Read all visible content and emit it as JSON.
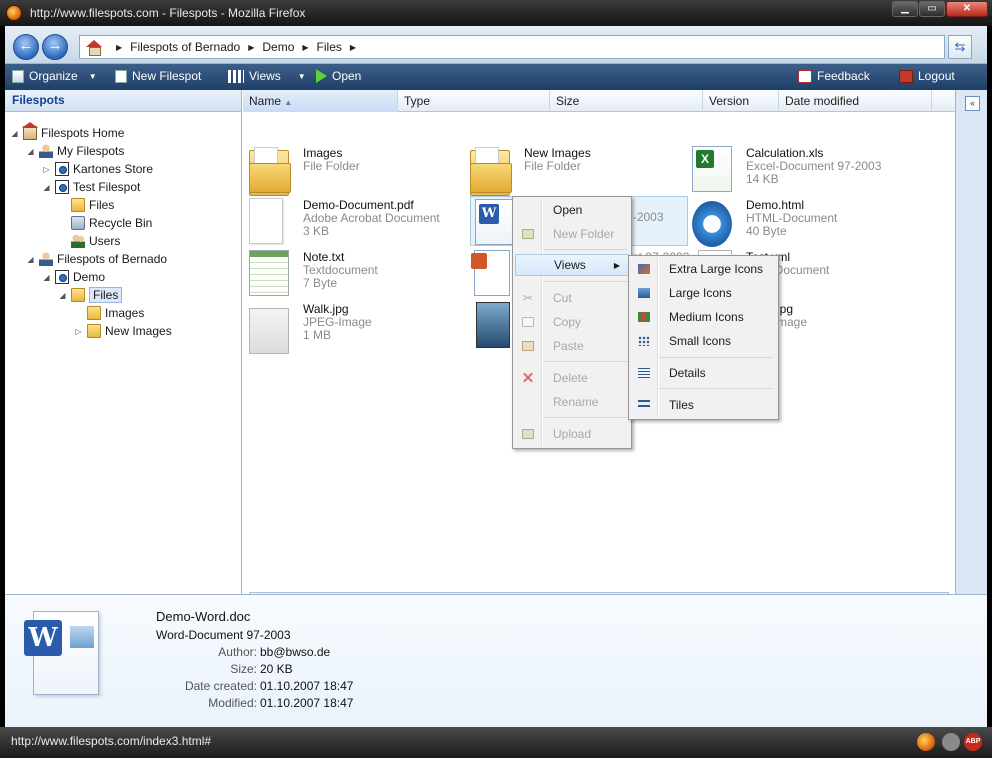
{
  "window": {
    "title": "http://www.filespots.com - Filespots - Mozilla Firefox"
  },
  "address": {
    "breadcrumbs": [
      "Filespots of Bernado",
      "Demo",
      "Files"
    ]
  },
  "toolbar": {
    "organize": "Organize",
    "new_filespot": "New Filespot",
    "views": "Views",
    "open": "Open",
    "feedback": "Feedback",
    "logout": "Logout"
  },
  "sidebar": {
    "header": "Filespots",
    "tree": [
      {
        "label": "Filespots Home",
        "icon": "home-icon"
      },
      {
        "label": "My Filespots",
        "icon": "user-icon"
      },
      {
        "label": "Kartones Store",
        "icon": "filespot-icon"
      },
      {
        "label": "Test Filespot",
        "icon": "filespot-icon"
      },
      {
        "label": "Files",
        "icon": "folder-icon"
      },
      {
        "label": "Recycle Bin",
        "icon": "recycle-bin-icon"
      },
      {
        "label": "Users",
        "icon": "users-icon"
      },
      {
        "label": "Filespots of Bernado",
        "icon": "user-icon"
      },
      {
        "label": "Demo",
        "icon": "filespot-icon"
      },
      {
        "label": "Files",
        "icon": "folder-icon"
      },
      {
        "label": "Images",
        "icon": "folder-icon"
      },
      {
        "label": "New Images",
        "icon": "folder-icon"
      }
    ]
  },
  "columns": [
    "Name",
    "Type",
    "Size",
    "Version",
    "Date modified"
  ],
  "files": [
    {
      "name": "Images",
      "type": "File Folder",
      "size": "",
      "icon": "folder-icon"
    },
    {
      "name": "New Images",
      "type": "File Folder",
      "size": "",
      "icon": "folder-icon"
    },
    {
      "name": "Calculation.xls",
      "type": "Excel-Document 97-2003",
      "size": "14 KB",
      "icon": "excel-icon"
    },
    {
      "name": "Demo-Document.pdf",
      "type": "Adobe Acrobat Document",
      "size": "3 KB",
      "icon": "pdf-icon"
    },
    {
      "name": "Demo-Word.doc",
      "type": "Word-Document 97-2003",
      "size": "",
      "icon": "word-icon"
    },
    {
      "name": "Demo.html",
      "type": "HTML-Document",
      "size": "40 Byte",
      "icon": "ie-icon"
    },
    {
      "name": "Note.txt",
      "type": "Textdocument",
      "size": "7 Byte",
      "icon": "notepad-icon"
    },
    {
      "name": "",
      "type": "nt 97-2003",
      "size": "",
      "icon": "powerpoint-icon"
    },
    {
      "name": "Test.xml",
      "type": "XML-Document",
      "size": "",
      "icon": "xml-icon"
    },
    {
      "name": "Walk.jpg",
      "type": "JPEG-Image",
      "size": "1 MB",
      "icon": "image-icon"
    },
    {
      "name": "",
      "type": "",
      "size": "",
      "icon": "image-icon"
    },
    {
      "name": "jpg",
      "type": "mage",
      "size": "",
      "icon": "image-icon"
    }
  ],
  "context_menu": {
    "items": [
      {
        "label": "Open",
        "disabled": false
      },
      {
        "label": "New Folder",
        "disabled": true
      },
      {
        "label": "Views",
        "disabled": false
      },
      {
        "label": "Cut",
        "disabled": true
      },
      {
        "label": "Copy",
        "disabled": true
      },
      {
        "label": "Paste",
        "disabled": true
      },
      {
        "label": "Delete",
        "disabled": true
      },
      {
        "label": "Rename",
        "disabled": true
      },
      {
        "label": "Upload",
        "disabled": true
      }
    ],
    "views_submenu": [
      "Extra Large Icons",
      "Large Icons",
      "Medium Icons",
      "Small Icons",
      "Details",
      "Tiles"
    ]
  },
  "details": {
    "name": "Demo-Word.doc",
    "type": "Word-Document 97-2003",
    "fields": [
      {
        "key": "Author:",
        "value": "bb@bwso.de"
      },
      {
        "key": "Size:",
        "value": "20 KB"
      },
      {
        "key": "Date created:",
        "value": "01.10.2007 18:47"
      },
      {
        "key": "Modified:",
        "value": "01.10.2007 18:47"
      }
    ]
  },
  "statusbar": {
    "url": "http://www.filespots.com/index3.html#",
    "adblock": "ABP"
  }
}
